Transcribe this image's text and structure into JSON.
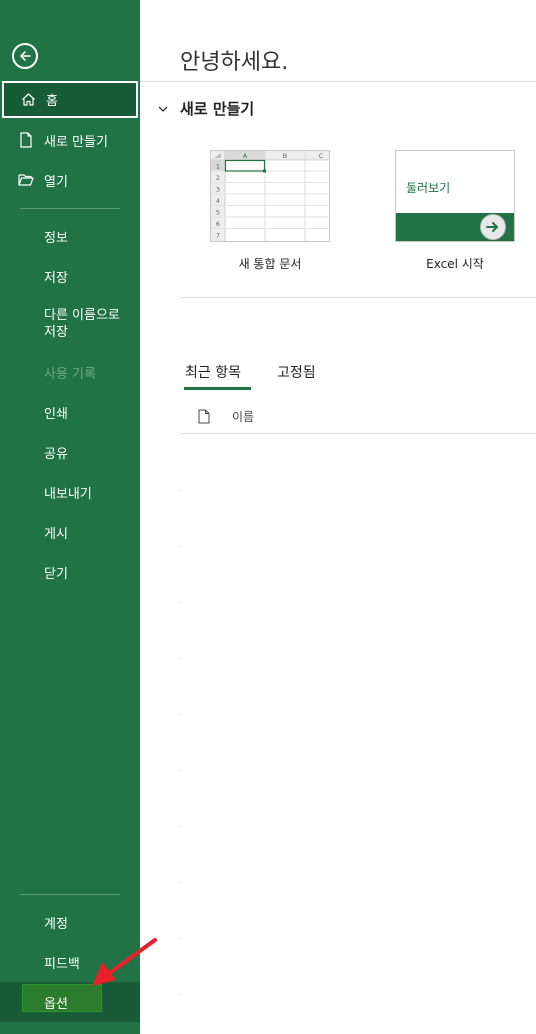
{
  "sidebar": {
    "back_icon": "back-arrow-icon",
    "home": "홈",
    "new": "새로 만들기",
    "open": "열기",
    "info": "정보",
    "save": "저장",
    "save_as_line1": "다른 이름으로",
    "save_as_line2": "저장",
    "history": "사용 기록",
    "print": "인쇄",
    "share": "공유",
    "export": "내보내기",
    "publish": "게시",
    "close": "닫기",
    "account": "계정",
    "feedback": "피드백",
    "options": "옵션"
  },
  "main": {
    "greeting": "안녕하세요.",
    "new_section": "새로 만들기",
    "templates": [
      {
        "label": "새 통합 문서"
      },
      {
        "label": "Excel 시작",
        "tile_text": "둘러보기"
      }
    ],
    "sheet_columns": [
      "A",
      "B",
      "C"
    ],
    "sheet_rows": [
      "1",
      "2",
      "3",
      "4",
      "5",
      "6",
      "7"
    ],
    "tabs": [
      "최근 항목",
      "고정됨"
    ],
    "list_header": "이름"
  },
  "colors": {
    "excel_green": "#217346",
    "dark_green": "#185c37",
    "annotation_red": "#e8202a"
  }
}
